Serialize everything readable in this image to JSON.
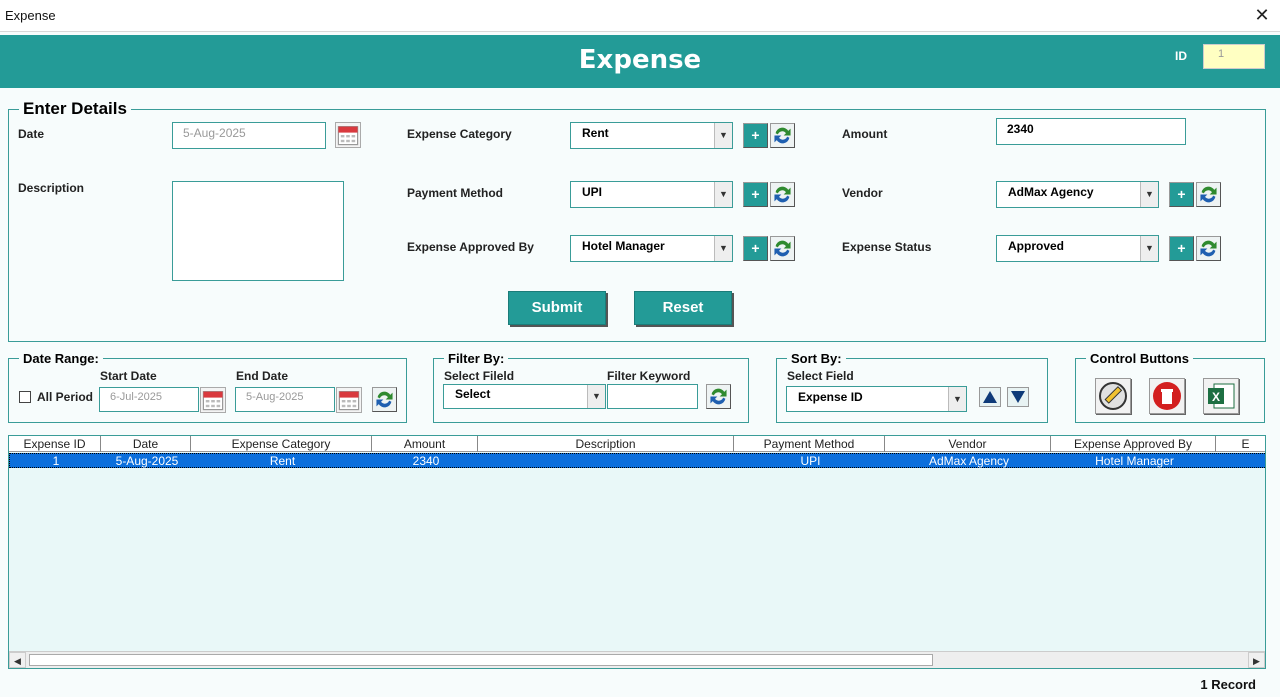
{
  "window": {
    "title": "Expense",
    "close_glyph": "✕"
  },
  "header": {
    "title": "Expense",
    "id_label": "ID",
    "id_value": "1"
  },
  "details": {
    "legend": "Enter Details",
    "date_label": "Date",
    "date_value": "5-Aug-2025",
    "description_label": "Description",
    "description_value": "",
    "category_label": "Expense Category",
    "category_value": "Rent",
    "payment_label": "Payment Method",
    "payment_value": "UPI",
    "approved_label": "Expense Approved By",
    "approved_value": "Hotel Manager",
    "amount_label": "Amount",
    "amount_value": "2340",
    "vendor_label": "Vendor",
    "vendor_value": "AdMax Agency",
    "status_label": "Expense Status",
    "status_value": "Approved",
    "submit_label": "Submit",
    "reset_label": "Reset"
  },
  "date_range": {
    "legend": "Date Range:",
    "all_period_label": "All Period",
    "all_period_checked": false,
    "start_label": "Start Date",
    "start_value": "6-Jul-2025",
    "end_label": "End Date",
    "end_value": "5-Aug-2025"
  },
  "filter": {
    "legend": "Filter By:",
    "field_label": "Select Fileld",
    "field_value": "Select",
    "keyword_label": "Filter Keyword",
    "keyword_value": ""
  },
  "sort": {
    "legend": "Sort By:",
    "field_label": "Select Field",
    "field_value": "Expense ID"
  },
  "controls": {
    "legend": "Control Buttons"
  },
  "table": {
    "columns": [
      "Expense ID",
      "Date",
      "Expense Category",
      "Amount",
      "Description",
      "Payment Method",
      "Vendor",
      "Expense Approved By",
      "E"
    ],
    "rows": [
      [
        "1",
        "5-Aug-2025",
        "Rent",
        "2340",
        "",
        "UPI",
        "AdMax Agency",
        "Hotel Manager",
        ""
      ]
    ]
  },
  "footer": {
    "record_count": "1 Record"
  },
  "colors": {
    "accent": "#239b97",
    "selection": "#0c6fdc",
    "id_box": "#ffffc2"
  },
  "icons": [
    "calendar-icon",
    "plus-icon",
    "refresh-icon",
    "edit-icon",
    "delete-icon",
    "excel-icon",
    "sort-up-icon",
    "sort-down-icon"
  ]
}
